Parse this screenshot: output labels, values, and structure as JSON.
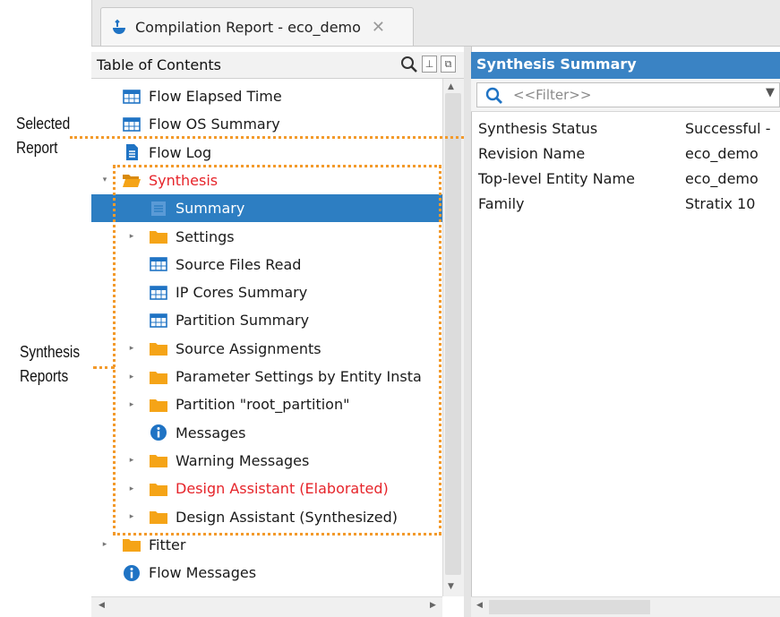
{
  "tab": {
    "title": "Compilation Report - eco_demo"
  },
  "toc": {
    "title": "Table of Contents",
    "items": [
      {
        "label": "Flow Elapsed Time",
        "icon": "table-icon",
        "level": 0,
        "expander": ""
      },
      {
        "label": "Flow OS Summary",
        "icon": "table-icon",
        "level": 0,
        "expander": ""
      },
      {
        "label": "Flow Log",
        "icon": "document-icon",
        "level": 0,
        "expander": ""
      },
      {
        "label": "Synthesis",
        "icon": "folder-open-icon",
        "level": 0,
        "expander": "▾",
        "color": "#e6242a"
      },
      {
        "label": "Summary",
        "icon": "list-icon",
        "level": 1,
        "expander": "",
        "selected": true
      },
      {
        "label": "Settings",
        "icon": "folder-icon",
        "level": 1,
        "expander": "▸"
      },
      {
        "label": "Source Files Read",
        "icon": "table-icon",
        "level": 1,
        "expander": ""
      },
      {
        "label": "IP Cores Summary",
        "icon": "table-icon",
        "level": 1,
        "expander": ""
      },
      {
        "label": "Partition Summary",
        "icon": "table-icon",
        "level": 1,
        "expander": ""
      },
      {
        "label": "Source Assignments",
        "icon": "folder-icon",
        "level": 1,
        "expander": "▸"
      },
      {
        "label": "Parameter Settings by Entity Insta",
        "icon": "folder-icon",
        "level": 1,
        "expander": "▸"
      },
      {
        "label": "Partition \"root_partition\"",
        "icon": "folder-icon",
        "level": 1,
        "expander": "▸"
      },
      {
        "label": "Messages",
        "icon": "info-icon",
        "level": 1,
        "expander": ""
      },
      {
        "label": "Warning Messages",
        "icon": "folder-icon",
        "level": 1,
        "expander": "▸"
      },
      {
        "label": "Design Assistant (Elaborated)",
        "icon": "folder-icon",
        "level": 1,
        "expander": "▸",
        "color": "#e6242a"
      },
      {
        "label": "Design Assistant (Synthesized)",
        "icon": "folder-icon",
        "level": 1,
        "expander": "▸"
      },
      {
        "label": "Fitter",
        "icon": "folder-icon",
        "level": 0,
        "expander": "▸"
      },
      {
        "label": "Flow Messages",
        "icon": "info-icon",
        "level": 0,
        "expander": ""
      }
    ]
  },
  "summary": {
    "title": "Synthesis Summary",
    "filter_placeholder": "<<Filter>>",
    "rows": [
      {
        "key": "Synthesis Status",
        "value": "Successful -"
      },
      {
        "key": "Revision Name",
        "value": "eco_demo"
      },
      {
        "key": "Top-level Entity Name",
        "value": "eco_demo"
      },
      {
        "key": "Family",
        "value": "Stratix 10"
      }
    ]
  },
  "annotations": {
    "selected_report": [
      "Selected",
      "Report"
    ],
    "synthesis_reports": [
      "Synthesis",
      "Reports"
    ]
  },
  "colors": {
    "selection": "#2d7ec2",
    "header": "#3a83c4",
    "highlight_text": "#e6242a",
    "annotation": "#f39a2b",
    "folder": "#f5a417",
    "icon_blue": "#1f73c4"
  }
}
